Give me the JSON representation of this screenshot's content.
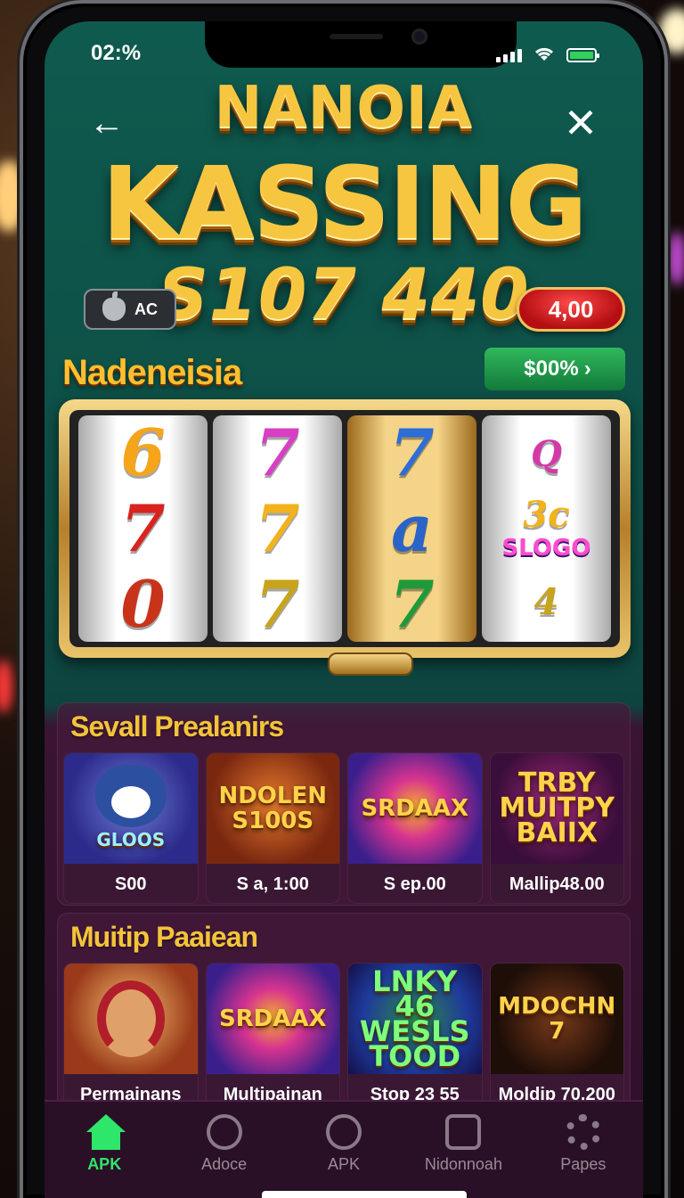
{
  "status_bar": {
    "time": "02:%"
  },
  "header": {
    "title_line1": "NANOIA",
    "title_line2": "KASSING",
    "title_line3": "S107 440"
  },
  "badges": {
    "apple_label": "AC",
    "credits": "4,00"
  },
  "brand": {
    "name": "Nadeneisia",
    "cta_label": "$00%"
  },
  "slot_machine": {
    "reels": [
      {
        "symbols": [
          "6",
          "7",
          "0"
        ]
      },
      {
        "symbols": [
          "7",
          "7",
          "7"
        ]
      },
      {
        "symbols": [
          "7",
          "a",
          "7"
        ]
      },
      {
        "symbols": [
          "Q",
          "3c",
          "4"
        ],
        "logo": "SLOGO"
      }
    ]
  },
  "section1": {
    "title": "Sevall Prealanirs",
    "cards": [
      {
        "thumb": "GLOOS",
        "caption": "S00"
      },
      {
        "thumb": "NDOLEN S100S",
        "caption": "S a, 1:00"
      },
      {
        "thumb": "SRDAAX",
        "caption": "S ep.00"
      },
      {
        "thumb": "TRBY MUITPY BAIIX",
        "caption": "Mallip48.00"
      }
    ]
  },
  "section2": {
    "title": "Muitip Paaiean",
    "cards": [
      {
        "thumb": "",
        "caption": "Permainans"
      },
      {
        "thumb": "SRDAAX",
        "caption": "Multipainan"
      },
      {
        "thumb": "LNKY 46 WESLS TOOD",
        "caption": "Stop 23 55"
      },
      {
        "thumb": "MDOCHN 7",
        "caption": "Moldjp 70.200"
      }
    ]
  },
  "tabbar": {
    "items": [
      {
        "label": "APK",
        "icon": "home-icon"
      },
      {
        "label": "Adoce",
        "icon": "target-icon"
      },
      {
        "label": "APK",
        "icon": "circle-icon"
      },
      {
        "label": "Nidonnoah",
        "icon": "box-icon"
      },
      {
        "label": "Papes",
        "icon": "gear-icon"
      }
    ]
  },
  "colors": {
    "accent_gold": "#f7c640",
    "active_tab": "#2ee66a",
    "credits_red": "#d21a1f"
  }
}
